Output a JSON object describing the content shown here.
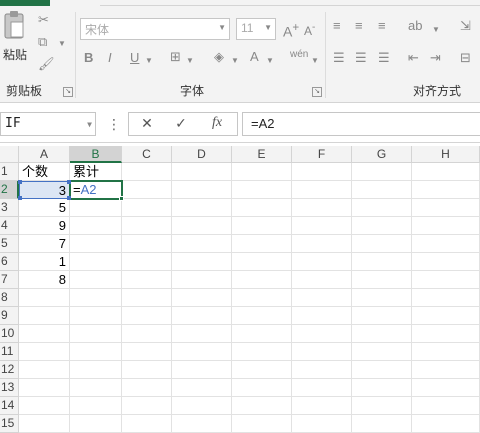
{
  "ribbon": {
    "clipboard": {
      "paste_label": "粘贴",
      "group_label": "剪贴板"
    },
    "font": {
      "font_name": "宋体",
      "font_size": "11",
      "group_label": "字体"
    },
    "alignment": {
      "group_label": "对齐方式"
    }
  },
  "formula_bar": {
    "name_box": "IF",
    "formula": "=A2"
  },
  "sheet": {
    "columns": [
      "A",
      "B",
      "C",
      "D",
      "E",
      "F",
      "G",
      "H"
    ],
    "rows": [
      "1",
      "2",
      "3",
      "4",
      "5",
      "6",
      "7",
      "8",
      "9",
      "10",
      "11",
      "12",
      "13",
      "14",
      "15"
    ],
    "cells": {
      "A1": "个数",
      "B1": "累计",
      "A2": "3",
      "A3": "5",
      "A4": "9",
      "A5": "7",
      "A6": "1",
      "A7": "8",
      "B2_eq": "=",
      "B2_ref": "A2"
    },
    "active_cell": "B2",
    "colors": {
      "accent": "#217346",
      "ref": "#4472c4"
    }
  }
}
